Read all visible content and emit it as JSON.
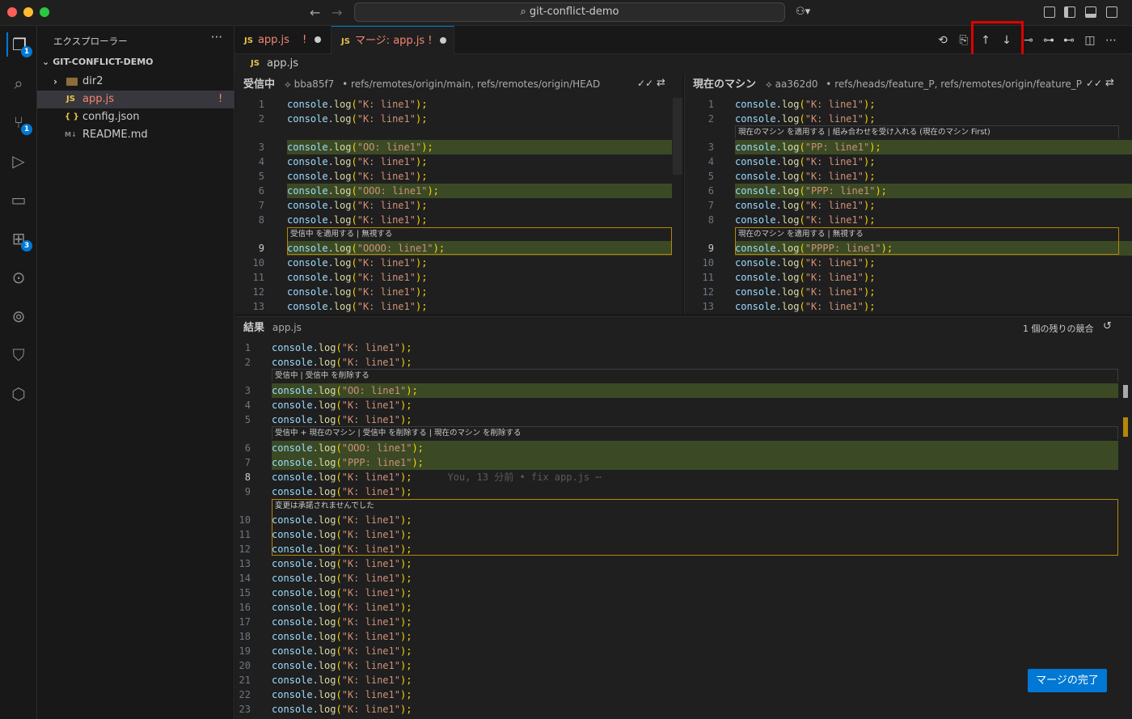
{
  "window": {
    "search": "git-conflict-demo"
  },
  "activity_badges": {
    "explorer": "1",
    "scm": "1",
    "extensions": "3"
  },
  "sidebar": {
    "title": "エクスプローラー",
    "more": "···",
    "folder": "GIT-CONFLICT-DEMO",
    "items": [
      {
        "label": "dir2",
        "icon": "folder-icon"
      },
      {
        "label": "app.js",
        "icon": "JS",
        "status": "!"
      },
      {
        "label": "config.json",
        "icon": "{ }"
      },
      {
        "label": "README.md",
        "icon": "M↓"
      }
    ]
  },
  "tabs": [
    {
      "icon": "JS",
      "label": "app.js",
      "status": "!"
    },
    {
      "icon": "JS",
      "label": "マージ: app.js",
      "status": "!"
    }
  ],
  "breadcrumb": {
    "icon": "JS",
    "file": "app.js"
  },
  "incoming": {
    "title": "受信中",
    "hash": "bba85f7",
    "refs": "• refs/remotes/origin/main, refs/remotes/origin/HEAD"
  },
  "current": {
    "title": "現在のマシン",
    "hash": "aa362d0",
    "refs": "• refs/heads/feature_P, refs/remotes/origin/feature_P"
  },
  "result": {
    "title": "結果",
    "file": "app.js",
    "remaining": "1 個の残りの競合",
    "blame": "You, 13 分前 • fix app.js ⋯"
  },
  "codelens": {
    "incoming_1": "受信中 を適用する | 無視する",
    "current_0": "現在のマシン を適用する | 組み合わせを受け入れる (現在のマシン First)",
    "current_1": "現在のマシン を適用する | 無視する",
    "result_0": "受信中 | 受信中 を削除する",
    "result_1": "受信中 + 現在のマシン | 受信中 を削除する | 現在のマシン を削除する",
    "result_2": "変更は承諾されませんでした"
  },
  "code": {
    "prefix": "console",
    "dot": ".",
    "func": "log",
    "open": "(",
    "close": ");",
    "incoming_lines": [
      "\"K: line1\"",
      "\"K: line1\"",
      "\"OO: line1\"",
      "\"K: line1\"",
      "\"K: line1\"",
      "\"OOO: line1\"",
      "\"K: line1\"",
      "\"K: line1\"",
      "\"OOOO: line1\"",
      "\"K: line1\"",
      "\"K: line1\"",
      "\"K: line1\"",
      "\"K: line1\""
    ],
    "current_lines": [
      "\"K: line1\"",
      "\"K: line1\"",
      "\"PP: line1\"",
      "\"K: line1\"",
      "\"K: line1\"",
      "\"PPP: line1\"",
      "\"K: line1\"",
      "\"K: line1\"",
      "\"PPPP: line1\"",
      "\"K: line1\"",
      "\"K: line1\"",
      "\"K: line1\"",
      "\"K: line1\""
    ],
    "result_lines": [
      "\"K: line1\"",
      "\"K: line1\"",
      "\"OO: line1\"",
      "\"K: line1\"",
      "\"K: line1\"",
      "\"OOO: line1\"",
      "\"PPP: line1\"",
      "\"K: line1\"",
      "\"K: line1\"",
      "\"K: line1\"",
      "\"K: line1\"",
      "\"K: line1\"",
      "\"K: line1\"",
      "\"K: line1\"",
      "\"K: line1\"",
      "\"K: line1\"",
      "\"K: line1\"",
      "\"K: line1\"",
      "\"K: line1\"",
      "\"K: line1\"",
      "\"K: line1\"",
      "\"K: line1\"",
      "\"K: line1\""
    ]
  },
  "complete_button": "マージの完了"
}
